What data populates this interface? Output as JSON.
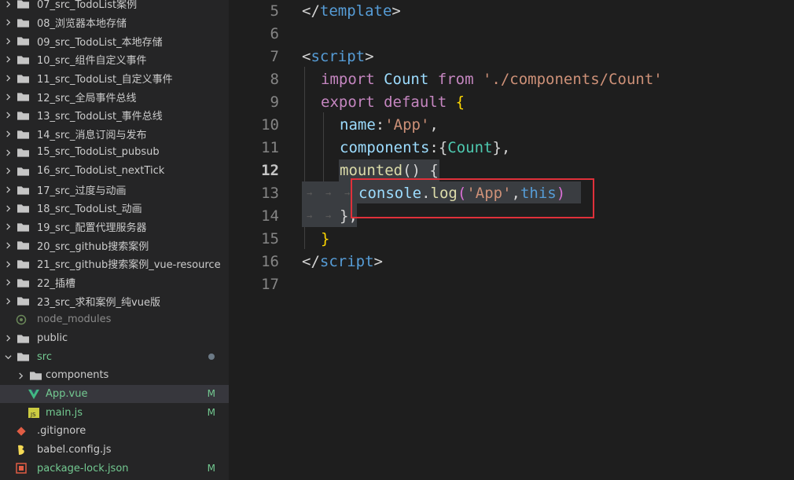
{
  "explorer": {
    "items": [
      {
        "label": "07_src_TodoList案例",
        "type": "folder",
        "expanded": false
      },
      {
        "label": "08_浏览器本地存储",
        "type": "folder",
        "expanded": false
      },
      {
        "label": "09_src_TodoList_本地存储",
        "type": "folder",
        "expanded": false
      },
      {
        "label": "10_src_组件自定义事件",
        "type": "folder",
        "expanded": false
      },
      {
        "label": "11_src_TodoList_自定义事件",
        "type": "folder",
        "expanded": false
      },
      {
        "label": "12_src_全局事件总线",
        "type": "folder",
        "expanded": false
      },
      {
        "label": "13_src_TodoList_事件总线",
        "type": "folder",
        "expanded": false
      },
      {
        "label": "14_src_消息订阅与发布",
        "type": "folder",
        "expanded": false
      },
      {
        "label": "15_src_TodoList_pubsub",
        "type": "folder",
        "expanded": false
      },
      {
        "label": "16_src_TodoList_nextTick",
        "type": "folder",
        "expanded": false
      },
      {
        "label": "17_src_过度与动画",
        "type": "folder",
        "expanded": false
      },
      {
        "label": "18_src_TodoList_动画",
        "type": "folder",
        "expanded": false
      },
      {
        "label": "19_src_配置代理服务器",
        "type": "folder",
        "expanded": false
      },
      {
        "label": "20_src_github搜索案例",
        "type": "folder",
        "expanded": false
      },
      {
        "label": "21_src_github搜索案例_vue-resource",
        "type": "folder",
        "expanded": false
      },
      {
        "label": "22_插槽",
        "type": "folder",
        "expanded": false
      },
      {
        "label": "23_src_求和案例_纯vue版",
        "type": "folder",
        "expanded": false
      },
      {
        "label": "node_modules",
        "type": "node_modules",
        "expanded": false
      },
      {
        "label": "public",
        "type": "folder",
        "expanded": false
      },
      {
        "label": "src",
        "type": "folder",
        "expanded": true
      },
      {
        "label": "components",
        "type": "folder",
        "expanded": false
      },
      {
        "label": "App.vue",
        "type": "vue",
        "badge": "M"
      },
      {
        "label": "main.js",
        "type": "js",
        "badge": "M"
      },
      {
        "label": ".gitignore",
        "type": "git"
      },
      {
        "label": "babel.config.js",
        "type": "babel"
      },
      {
        "label": "package-lock.json",
        "type": "json",
        "badge": "M"
      }
    ]
  },
  "editor": {
    "lines": [
      5,
      6,
      7,
      8,
      9,
      10,
      11,
      12,
      13,
      14,
      15,
      16,
      17
    ],
    "active_line": 12,
    "code": {
      "l5_a": "</",
      "l5_b": "template",
      "l5_c": ">",
      "l7_a": "<",
      "l7_b": "script",
      "l7_c": ">",
      "l8_kw": "import",
      "l8_name": "Count",
      "l8_from": "from",
      "l8_str": "'./components/Count'",
      "l9_kw1": "export",
      "l9_kw2": "default",
      "l9_brace": "{",
      "l10_prop": "name",
      "l10_colon": ":",
      "l10_str": "'App'",
      "l10_comma": ",",
      "l11_prop": "components",
      "l11_rest": ":{",
      "l11_cls": "Count",
      "l11_end": "},",
      "l12_fn": "mounted",
      "l12_rest": "() {",
      "l13_obj": "console",
      "l13_dot": ".",
      "l13_fn": "log",
      "l13_p1": "(",
      "l13_str": "'App'",
      "l13_comma": ",",
      "l13_this": "this",
      "l13_p2": ")",
      "l14": "},",
      "l15": "}",
      "l16_a": "</",
      "l16_b": "script",
      "l16_c": ">"
    }
  },
  "colors": {
    "highlight_box": "#e0303a"
  }
}
